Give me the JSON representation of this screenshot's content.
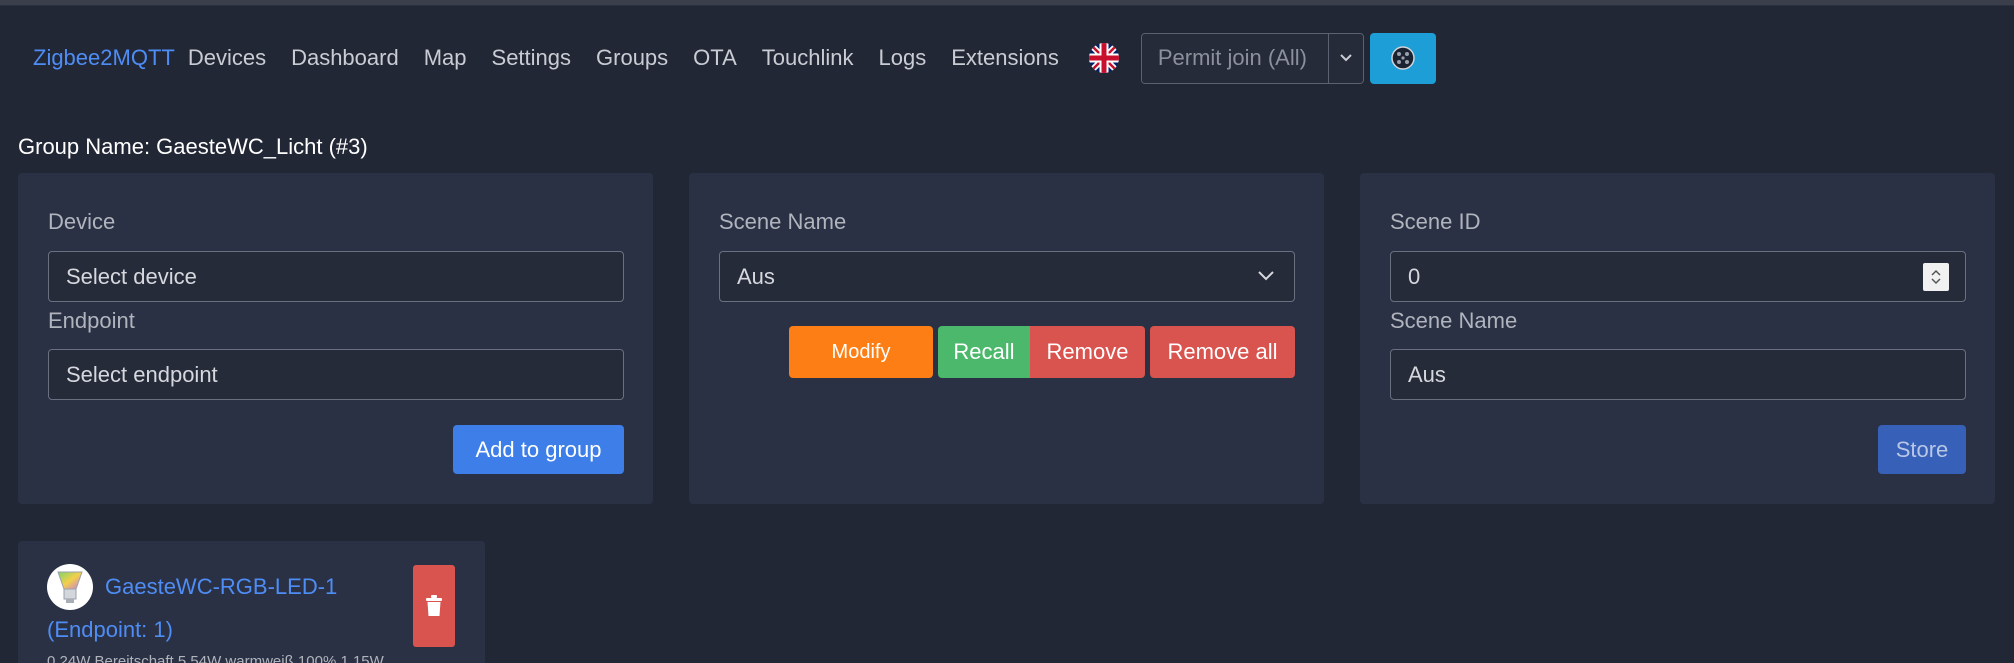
{
  "nav": {
    "brand": "Zigbee2MQTT",
    "links": [
      "Devices",
      "Dashboard",
      "Map",
      "Settings",
      "Groups",
      "OTA",
      "Touchlink",
      "Logs",
      "Extensions"
    ],
    "permit_join": "Permit join (All)"
  },
  "group": {
    "title": "Group Name: GaesteWC_Licht (#3)"
  },
  "add_device": {
    "device_label": "Device",
    "device_placeholder": "Select device",
    "endpoint_label": "Endpoint",
    "endpoint_placeholder": "Select endpoint",
    "add_button": "Add to group"
  },
  "scenes": {
    "scene_name_label": "Scene Name",
    "scene_selected": "Aus",
    "modify": "Modify",
    "recall": "Recall",
    "remove": "Remove",
    "remove_all": "Remove all"
  },
  "store_scene": {
    "scene_id_label": "Scene ID",
    "scene_id_value": "0",
    "scene_name_label": "Scene Name",
    "scene_name_value": "Aus",
    "store_button": "Store"
  },
  "member": {
    "name": "GaesteWC-RGB-LED-1",
    "endpoint": "(Endpoint: 1)",
    "description": "0.24W Bereitschaft 5.54W warmweiß 100% 1.15W"
  },
  "colors": {
    "background": "#222736",
    "card": "#2b3144",
    "accent_blue": "#4e8df5",
    "modify": "#fd7e14",
    "recall": "#4cb86b",
    "danger": "#d9534f"
  }
}
